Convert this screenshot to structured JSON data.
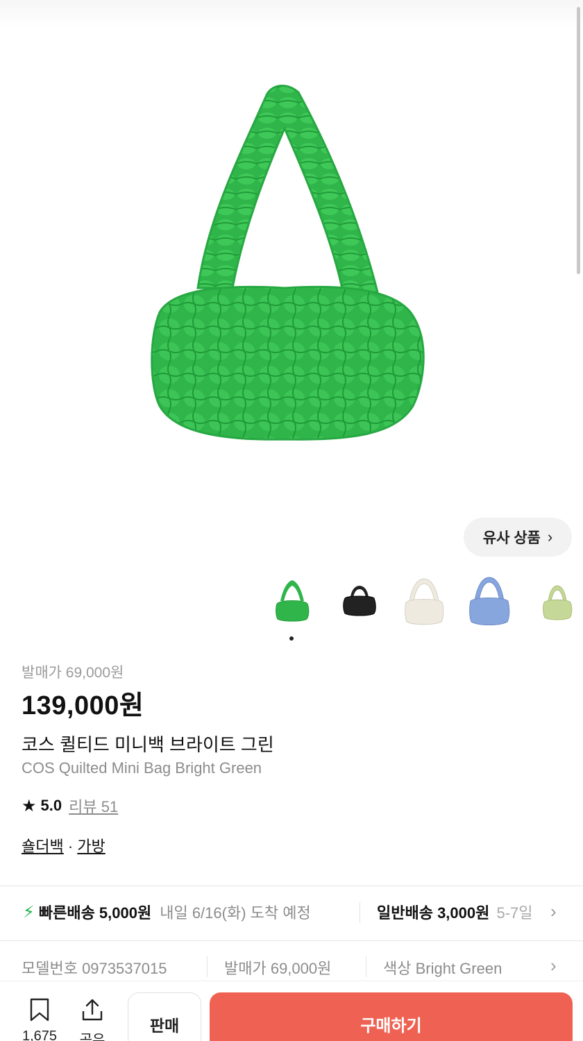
{
  "product": {
    "image_alt": "green quilted shoulder bag",
    "similar_button": "유사 상품",
    "thumbnails": [
      {
        "color": "#2fb54a",
        "name": "Bright Green"
      },
      {
        "color": "#222222",
        "name": "Black"
      },
      {
        "color": "#eeeae0",
        "name": "Ivory"
      },
      {
        "color": "#88a6de",
        "name": "Blue"
      },
      {
        "color": "#c6d897",
        "name": "Light Green"
      }
    ],
    "release_price_label": "발매가 69,000원",
    "price": "139,000원",
    "name_ko": "코스 퀼티드 미니백 브라이트 그린",
    "name_en": "COS Quilted Mini Bag Bright Green",
    "rating": "5.0",
    "reviews": "리뷰 51",
    "category_1": "숄더백",
    "category_sep": "·",
    "category_2": "가방"
  },
  "shipping": {
    "fast_label": "빠른배송 5,000원",
    "fast_eta": "내일 6/16(화) 도착 예정",
    "normal_label": "일반배송 3,000원",
    "normal_eta": "5-7일"
  },
  "info": {
    "model": "모델번호 0973537015",
    "release": "발매가 69,000원",
    "color": "색상 Bright Green"
  },
  "bottom": {
    "bookmark_count": "1,675",
    "share_label": "공유",
    "sell_label": "판매",
    "buy_label": "구매하기"
  },
  "colors": {
    "accent_buy": "#ef6253",
    "fast_ship": "#22b24c",
    "bag_green": "#2fb54a"
  }
}
